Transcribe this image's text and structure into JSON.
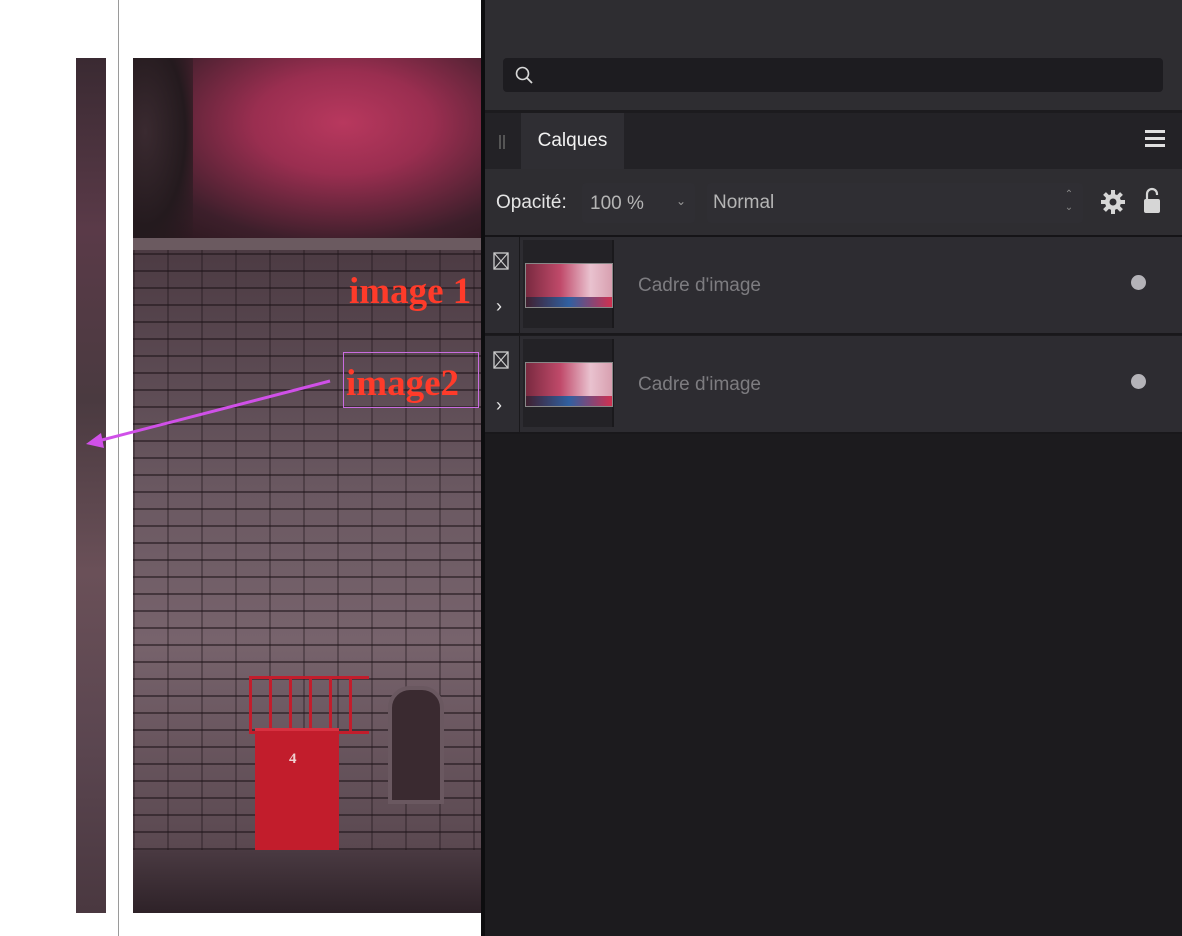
{
  "canvas": {
    "annotation_1": "image 1",
    "annotation_2": "image2",
    "door_number": "4",
    "accent_colors": {
      "annotation": "#ff3b2a",
      "arrow": "#d050e8"
    }
  },
  "panel": {
    "search": {
      "placeholder": "",
      "value": ""
    },
    "tabs": [
      {
        "label": "Calques"
      }
    ],
    "toolbar": {
      "opacity_label": "Opacité:",
      "opacity_value": "100 %",
      "blend_mode": "Normal"
    },
    "layers": [
      {
        "name": "Cadre d'image",
        "visible": true
      },
      {
        "name": "Cadre d'image",
        "visible": true
      }
    ]
  }
}
